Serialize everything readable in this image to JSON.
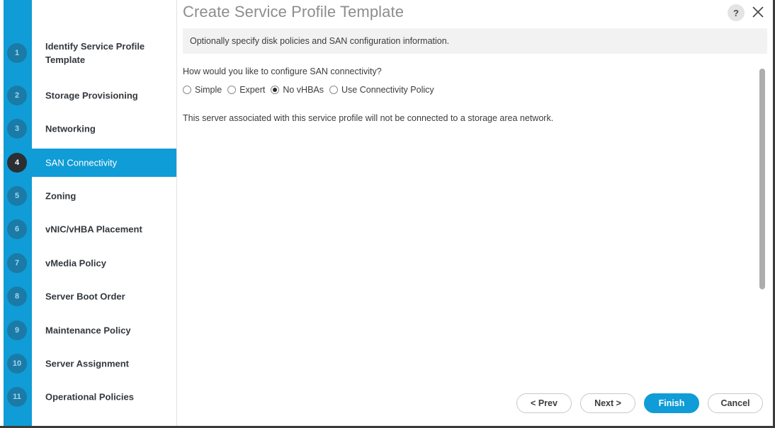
{
  "window": {
    "title": "Create Service Profile Template",
    "help_icon": "question-mark-icon",
    "help_label": "?",
    "close_icon": "close-icon",
    "subtitle": "Optionally specify disk policies and SAN configuration information."
  },
  "colors": {
    "accent": "#0f9cd7",
    "rail": "#0f9cd7",
    "step_badge": "#1b7ba6",
    "step_badge_active": "#2b2f33",
    "title_text": "#8d8d8d",
    "body_text": "#3c3c3c",
    "sidebar_text": "#33383d",
    "subtitle_bg": "#f2f2f2",
    "scrollbar_thumb": "#adadad",
    "dialog_border": "#3a3a3a"
  },
  "sidebar": {
    "steps": [
      {
        "number": "1",
        "label": "Identify Service Profile Template",
        "active": false
      },
      {
        "number": "2",
        "label": "Storage Provisioning",
        "active": false
      },
      {
        "number": "3",
        "label": "Networking",
        "active": false
      },
      {
        "number": "4",
        "label": "SAN Connectivity",
        "active": true
      },
      {
        "number": "5",
        "label": "Zoning",
        "active": false
      },
      {
        "number": "6",
        "label": "vNIC/vHBA Placement",
        "active": false
      },
      {
        "number": "7",
        "label": "vMedia Policy",
        "active": false
      },
      {
        "number": "8",
        "label": "Server Boot Order",
        "active": false
      },
      {
        "number": "9",
        "label": "Maintenance Policy",
        "active": false
      },
      {
        "number": "10",
        "label": "Server Assignment",
        "active": false
      },
      {
        "number": "11",
        "label": "Operational Policies",
        "active": false
      }
    ]
  },
  "content": {
    "question": "How would you like to configure SAN connectivity?",
    "radio_options": [
      {
        "label": "Simple",
        "checked": false
      },
      {
        "label": "Expert",
        "checked": false
      },
      {
        "label": "No vHBAs",
        "checked": true
      },
      {
        "label": "Use Connectivity Policy",
        "checked": false
      }
    ],
    "description": "This server associated with this service profile will not be connected to a storage area network."
  },
  "footer": {
    "buttons": [
      {
        "label": "< Prev",
        "primary": false
      },
      {
        "label": "Next >",
        "primary": false
      },
      {
        "label": "Finish",
        "primary": true
      },
      {
        "label": "Cancel",
        "primary": false
      }
    ]
  }
}
